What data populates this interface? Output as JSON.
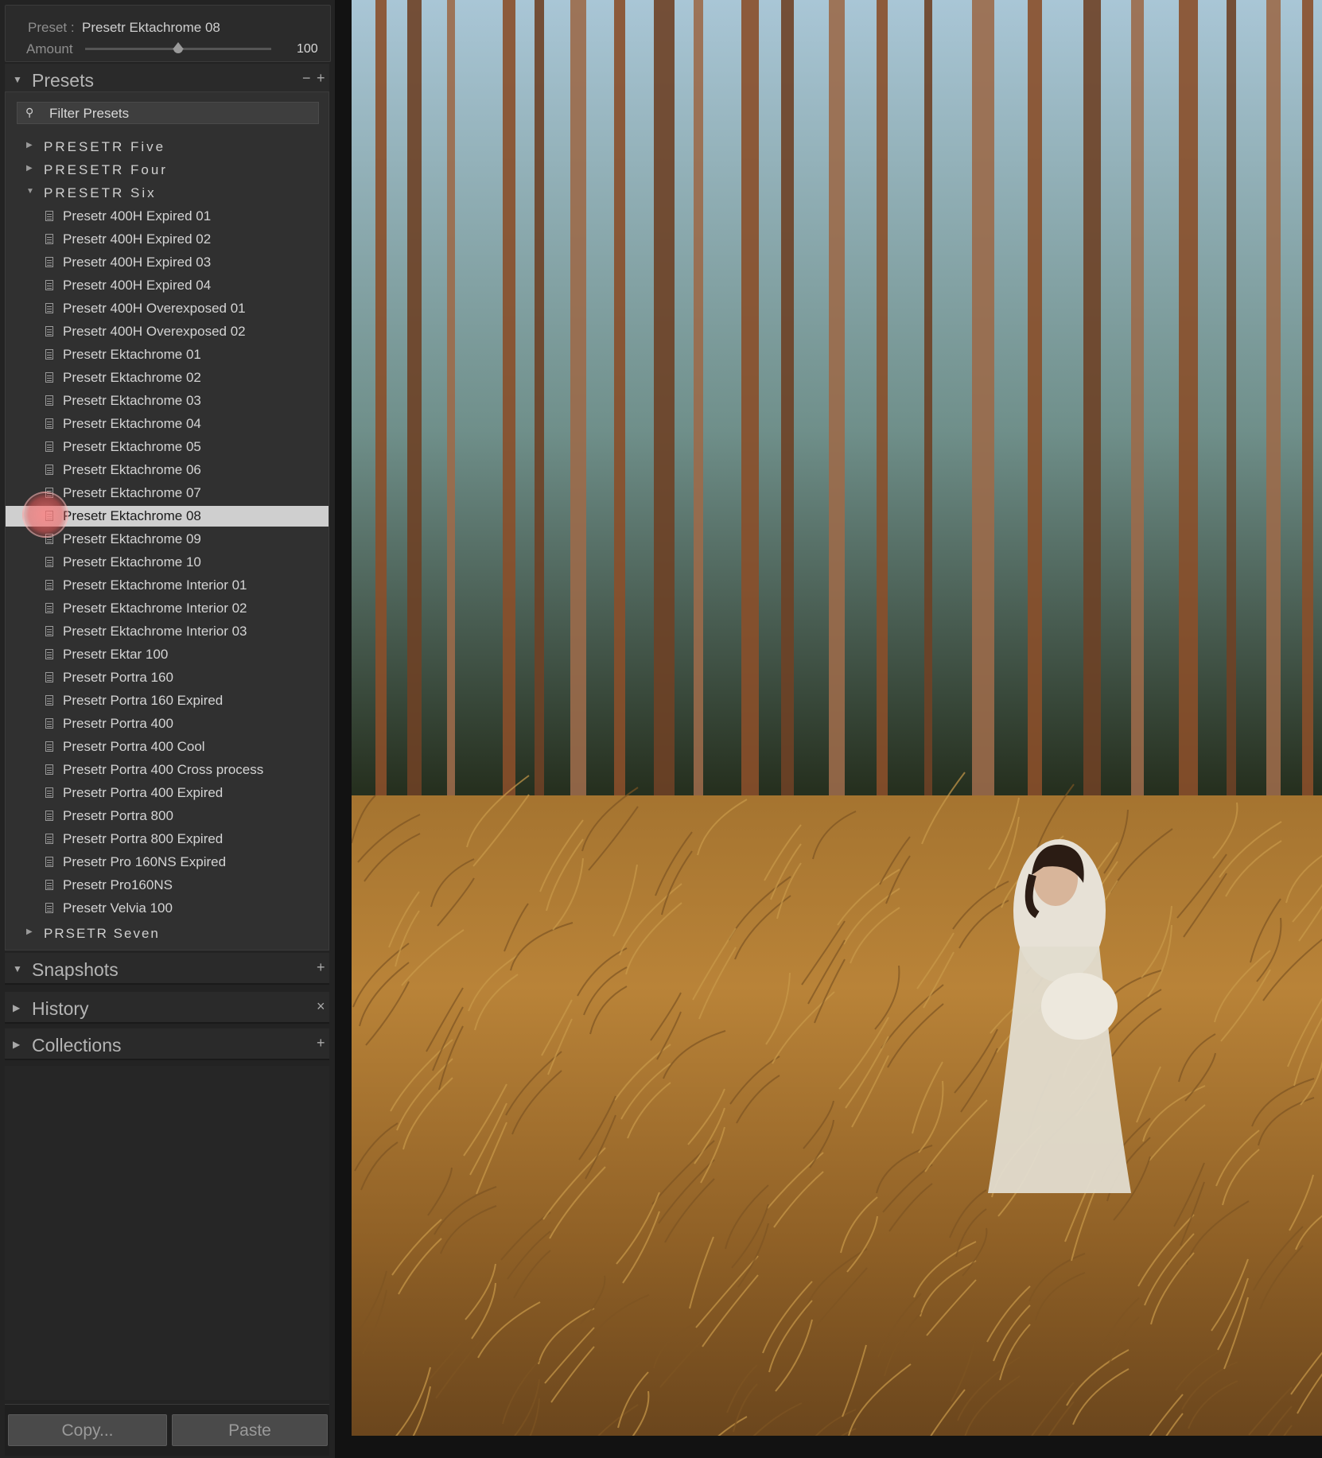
{
  "navigator": {
    "preset_label": "Preset :",
    "preset_value": "Presetr Ektachrome 08",
    "amount_label": "Amount",
    "amount_value": "100",
    "amount_fraction": 0.5
  },
  "sections": {
    "presets": {
      "title": "Presets",
      "minus": "−",
      "plus": "+"
    },
    "snapshots": {
      "title": "Snapshots",
      "plus": "+"
    },
    "history": {
      "title": "History",
      "close": "×"
    },
    "collections": {
      "title": "Collections",
      "plus": "+"
    }
  },
  "filter": {
    "placeholder": "Filter Presets"
  },
  "folders": {
    "five": "PRESETR Five",
    "four": "PRESETR Four",
    "six": "PRESETR Six",
    "seven": "PRSETR Seven"
  },
  "presets_six": [
    "Presetr 400H Expired 01",
    "Presetr 400H Expired 02",
    "Presetr 400H Expired 03",
    "Presetr 400H Expired 04",
    "Presetr 400H Overexposed 01",
    "Presetr 400H Overexposed 02",
    "Presetr Ektachrome 01",
    "Presetr Ektachrome 02",
    "Presetr Ektachrome 03",
    "Presetr Ektachrome 04",
    "Presetr Ektachrome 05",
    "Presetr Ektachrome 06",
    "Presetr Ektachrome 07",
    "Presetr Ektachrome 08",
    "Presetr Ektachrome 09",
    "Presetr Ektachrome 10",
    "Presetr Ektachrome Interior 01",
    "Presetr Ektachrome Interior 02",
    "Presetr Ektachrome Interior 03",
    "Presetr Ektar 100",
    "Presetr Portra 160",
    "Presetr Portra 160 Expired",
    "Presetr Portra 400",
    "Presetr Portra 400 Cool",
    "Presetr Portra 400 Cross process",
    "Presetr Portra 400 Expired",
    "Presetr Portra 800",
    "Presetr Portra 800 Expired",
    "Presetr Pro 160NS Expired",
    "Presetr Pro160NS",
    "Presetr Velvia 100"
  ],
  "selected_index": 13,
  "buttons": {
    "copy": "Copy...",
    "paste": "Paste"
  }
}
